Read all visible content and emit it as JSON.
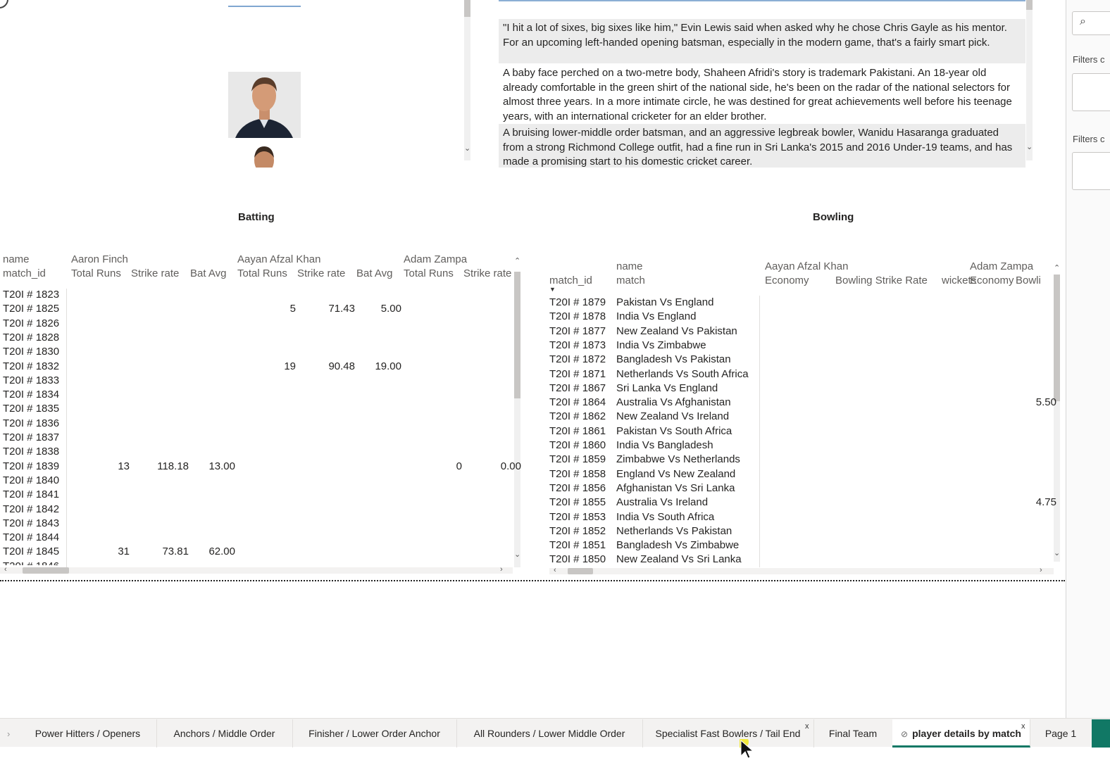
{
  "bios": [
    "\"I hit a lot of sixes, big sixes like him,\" Evin Lewis said when asked why he chose Chris Gayle as his mentor. For an upcoming left-handed opening batsman, especially in the modern game, that's a fairly smart pick.",
    "A baby face perched on a two-metre body, Shaheen Afridi's story is trademark Pakistani. An 18-year old already comfortable in the green shirt of the national side, he's been on the radar of the national selectors for almost three years. In a more intimate circle, he was destined for great achievements well before his teenage years, with an international cricketer for an elder brother.",
    "A bruising lower-middle order batsman, and an aggressive legbreak bowler, Wanidu Hasaranga graduated from a strong Richmond College outfit, had a fine run in Sri Lanka's 2015 and 2016 Under-19 teams, and has made a promising start to his domestic cricket career."
  ],
  "batting": {
    "title": "Batting",
    "row_header_top": "name",
    "row_header_bottom": "match_id",
    "players": [
      "Aaron Finch",
      "Aayan Afzal Khan",
      "Adam Zampa"
    ],
    "columns": [
      "Total Runs",
      "Strike rate",
      "Bat Avg",
      "Total Runs",
      "Strike rate",
      "Bat Avg",
      "Total Runs",
      "Strike rate"
    ],
    "rows": [
      {
        "id": "T20I # 1823",
        "v": [
          "",
          "",
          "",
          "",
          "",
          "",
          "",
          ""
        ]
      },
      {
        "id": "T20I # 1825",
        "v": [
          "",
          "",
          "",
          "5",
          "71.43",
          "5.00",
          "",
          ""
        ]
      },
      {
        "id": "T20I # 1826",
        "v": [
          "",
          "",
          "",
          "",
          "",
          "",
          "",
          ""
        ]
      },
      {
        "id": "T20I # 1828",
        "v": [
          "",
          "",
          "",
          "",
          "",
          "",
          "",
          ""
        ]
      },
      {
        "id": "T20I # 1830",
        "v": [
          "",
          "",
          "",
          "",
          "",
          "",
          "",
          ""
        ]
      },
      {
        "id": "T20I # 1832",
        "v": [
          "",
          "",
          "",
          "19",
          "90.48",
          "19.00",
          "",
          ""
        ]
      },
      {
        "id": "T20I # 1833",
        "v": [
          "",
          "",
          "",
          "",
          "",
          "",
          "",
          ""
        ]
      },
      {
        "id": "T20I # 1834",
        "v": [
          "",
          "",
          "",
          "",
          "",
          "",
          "",
          ""
        ]
      },
      {
        "id": "T20I # 1835",
        "v": [
          "",
          "",
          "",
          "",
          "",
          "",
          "",
          ""
        ]
      },
      {
        "id": "T20I # 1836",
        "v": [
          "",
          "",
          "",
          "",
          "",
          "",
          "",
          ""
        ]
      },
      {
        "id": "T20I # 1837",
        "v": [
          "",
          "",
          "",
          "",
          "",
          "",
          "",
          ""
        ]
      },
      {
        "id": "T20I # 1838",
        "v": [
          "",
          "",
          "",
          "",
          "",
          "",
          "",
          ""
        ]
      },
      {
        "id": "T20I # 1839",
        "v": [
          "13",
          "118.18",
          "13.00",
          "",
          "",
          "",
          "0",
          "0.00"
        ]
      },
      {
        "id": "T20I # 1840",
        "v": [
          "",
          "",
          "",
          "",
          "",
          "",
          "",
          ""
        ]
      },
      {
        "id": "T20I # 1841",
        "v": [
          "",
          "",
          "",
          "",
          "",
          "",
          "",
          ""
        ]
      },
      {
        "id": "T20I # 1842",
        "v": [
          "",
          "",
          "",
          "",
          "",
          "",
          "",
          ""
        ]
      },
      {
        "id": "T20I # 1843",
        "v": [
          "",
          "",
          "",
          "",
          "",
          "",
          "",
          ""
        ]
      },
      {
        "id": "T20I # 1844",
        "v": [
          "",
          "",
          "",
          "",
          "",
          "",
          "",
          ""
        ]
      },
      {
        "id": "T20I # 1845",
        "v": [
          "31",
          "73.81",
          "62.00",
          "",
          "",
          "",
          "",
          ""
        ]
      }
    ],
    "partial_row": "T20I # 1846"
  },
  "bowling": {
    "title": "Bowling",
    "row_header": "match_id",
    "name_header_top": "name",
    "name_header_bottom": "match",
    "players": [
      "Aayan Afzal Khan",
      "Adam Zampa"
    ],
    "columns": [
      "Economy",
      "Bowling Strike Rate",
      "wickets",
      "Economy",
      "Bowli"
    ],
    "rows": [
      {
        "id": "T20I # 1879",
        "match": "Pakistan Vs England",
        "v": [
          "",
          "",
          "",
          "",
          ""
        ]
      },
      {
        "id": "T20I # 1878",
        "match": "India Vs England",
        "v": [
          "",
          "",
          "",
          "",
          ""
        ]
      },
      {
        "id": "T20I # 1877",
        "match": "New Zealand Vs Pakistan",
        "v": [
          "",
          "",
          "",
          "",
          ""
        ]
      },
      {
        "id": "T20I # 1873",
        "match": "India Vs Zimbabwe",
        "v": [
          "",
          "",
          "",
          "",
          ""
        ]
      },
      {
        "id": "T20I # 1872",
        "match": "Bangladesh Vs Pakistan",
        "v": [
          "",
          "",
          "",
          "",
          ""
        ]
      },
      {
        "id": "T20I # 1871",
        "match": "Netherlands Vs South Africa",
        "v": [
          "",
          "",
          "",
          "",
          ""
        ]
      },
      {
        "id": "T20I # 1867",
        "match": "Sri Lanka Vs England",
        "v": [
          "",
          "",
          "",
          "",
          ""
        ]
      },
      {
        "id": "T20I # 1864",
        "match": "Australia Vs Afghanistan",
        "v": [
          "",
          "",
          "",
          "5.50",
          ""
        ]
      },
      {
        "id": "T20I # 1862",
        "match": "New Zealand Vs Ireland",
        "v": [
          "",
          "",
          "",
          "",
          ""
        ]
      },
      {
        "id": "T20I # 1861",
        "match": "Pakistan Vs South Africa",
        "v": [
          "",
          "",
          "",
          "",
          ""
        ]
      },
      {
        "id": "T20I # 1860",
        "match": "India Vs Bangladesh",
        "v": [
          "",
          "",
          "",
          "",
          ""
        ]
      },
      {
        "id": "T20I # 1859",
        "match": "Zimbabwe Vs Netherlands",
        "v": [
          "",
          "",
          "",
          "",
          ""
        ]
      },
      {
        "id": "T20I # 1858",
        "match": "England Vs New Zealand",
        "v": [
          "",
          "",
          "",
          "",
          ""
        ]
      },
      {
        "id": "T20I # 1856",
        "match": "Afghanistan Vs Sri Lanka",
        "v": [
          "",
          "",
          "",
          "",
          ""
        ]
      },
      {
        "id": "T20I # 1855",
        "match": "Australia Vs Ireland",
        "v": [
          "",
          "",
          "",
          "4.75",
          ""
        ]
      },
      {
        "id": "T20I # 1853",
        "match": "India Vs South Africa",
        "v": [
          "",
          "",
          "",
          "",
          ""
        ]
      },
      {
        "id": "T20I # 1852",
        "match": "Netherlands Vs Pakistan",
        "v": [
          "",
          "",
          "",
          "",
          ""
        ]
      },
      {
        "id": "T20I # 1851",
        "match": "Bangladesh Vs Zimbabwe",
        "v": [
          "",
          "",
          "",
          "",
          ""
        ]
      },
      {
        "id": "T20I # 1850",
        "match": "New Zealand Vs Sri Lanka",
        "v": [
          "",
          "",
          "",
          "",
          ""
        ]
      }
    ]
  },
  "filters": {
    "label_1": "Filters c",
    "label_2": "Filters c",
    "search_icon": "search-icon"
  },
  "tabs": [
    {
      "label": "Power Hitters / Openers"
    },
    {
      "label": "Anchors / Middle Order"
    },
    {
      "label": "Finisher / Lower Order Anchor"
    },
    {
      "label": "All Rounders / Lower Middle Order"
    },
    {
      "label": "Specialist Fast Bowlers / Tail End",
      "close": "x"
    },
    {
      "label": "Final Team"
    },
    {
      "label": "player details by match",
      "close": "x",
      "active": true,
      "icon": "hidden-page-icon"
    },
    {
      "label": "Page 1"
    }
  ],
  "colors": {
    "accent": "#117865",
    "header_text": "#605e5c",
    "cursor_highlight": "#f2e600"
  }
}
